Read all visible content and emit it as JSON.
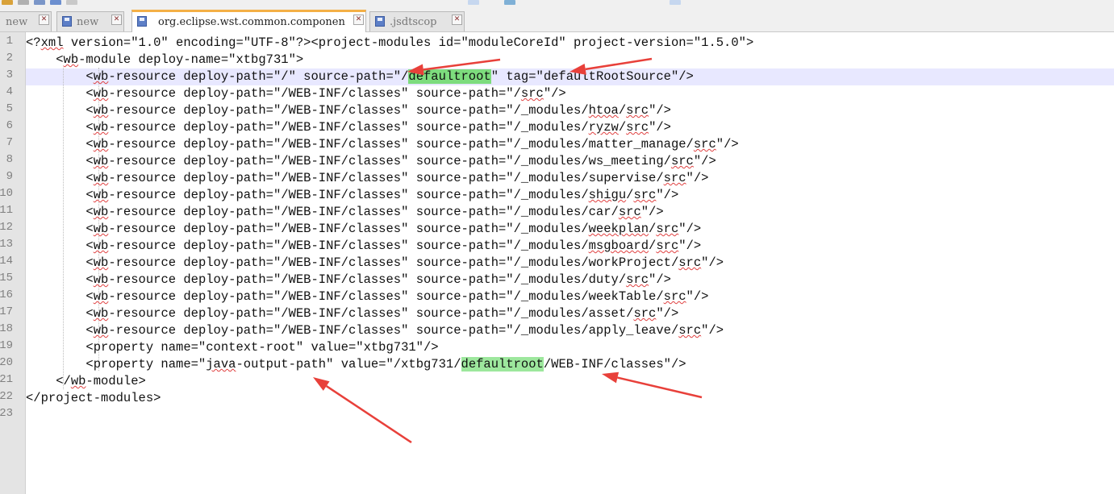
{
  "tabs": [
    {
      "label": "new",
      "active": false
    },
    {
      "label": "new",
      "active": false
    },
    {
      "label": "org.eclipse.wst.common.componen",
      "active": true
    },
    {
      "label": ".jsdtscop",
      "active": false
    }
  ],
  "line_numbers": [
    "1",
    "2",
    "3",
    "4",
    "5",
    "6",
    "7",
    "8",
    "9",
    "10",
    "11",
    "12",
    "13",
    "14",
    "15",
    "16",
    "17",
    "18",
    "19",
    "20",
    "21",
    "22",
    "23"
  ],
  "current_line": "3",
  "code_lines": [
    "<?xml version=\"1.0\" encoding=\"UTF-8\"?><project-modules id=\"moduleCoreId\" project-version=\"1.5.0\">",
    "    <wb-module deploy-name=\"xtbg731\">",
    "        <wb-resource deploy-path=\"/\" source-path=\"/defaultroot\" tag=\"defaultRootSource\"/>",
    "        <wb-resource deploy-path=\"/WEB-INF/classes\" source-path=\"/src\"/>",
    "        <wb-resource deploy-path=\"/WEB-INF/classes\" source-path=\"/_modules/htoa/src\"/>",
    "        <wb-resource deploy-path=\"/WEB-INF/classes\" source-path=\"/_modules/ryzw/src\"/>",
    "        <wb-resource deploy-path=\"/WEB-INF/classes\" source-path=\"/_modules/matter_manage/src\"/>",
    "        <wb-resource deploy-path=\"/WEB-INF/classes\" source-path=\"/_modules/ws_meeting/src\"/>",
    "        <wb-resource deploy-path=\"/WEB-INF/classes\" source-path=\"/_modules/supervise/src\"/>",
    "        <wb-resource deploy-path=\"/WEB-INF/classes\" source-path=\"/_modules/shigu/src\"/>",
    "        <wb-resource deploy-path=\"/WEB-INF/classes\" source-path=\"/_modules/car/src\"/>",
    "        <wb-resource deploy-path=\"/WEB-INF/classes\" source-path=\"/_modules/weekplan/src\"/>",
    "        <wb-resource deploy-path=\"/WEB-INF/classes\" source-path=\"/_modules/msgboard/src\"/>",
    "        <wb-resource deploy-path=\"/WEB-INF/classes\" source-path=\"/_modules/workProject/src\"/>",
    "        <wb-resource deploy-path=\"/WEB-INF/classes\" source-path=\"/_modules/duty/src\"/>",
    "        <wb-resource deploy-path=\"/WEB-INF/classes\" source-path=\"/_modules/weekTable/src\"/>",
    "        <wb-resource deploy-path=\"/WEB-INF/classes\" source-path=\"/_modules/asset/src\"/>",
    "        <wb-resource deploy-path=\"/WEB-INF/classes\" source-path=\"/_modules/apply_leave/src\"/>",
    "        <property name=\"context-root\" value=\"xtbg731\"/>",
    "        <property name=\"java-output-path\" value=\"/xtbg731/defaultroot/WEB-INF/classes\"/>",
    "    </wb-module>",
    "</project-modules>",
    ""
  ],
  "highlight_word": "defaultroot",
  "colors": {
    "highlight": "#7ddc7d",
    "current_line": "#e8e8ff",
    "arrow": "#e8403a",
    "active_tab_accent": "#f4b046"
  },
  "icons": [
    "file-icon",
    "close-icon",
    "arrow-annotation"
  ]
}
